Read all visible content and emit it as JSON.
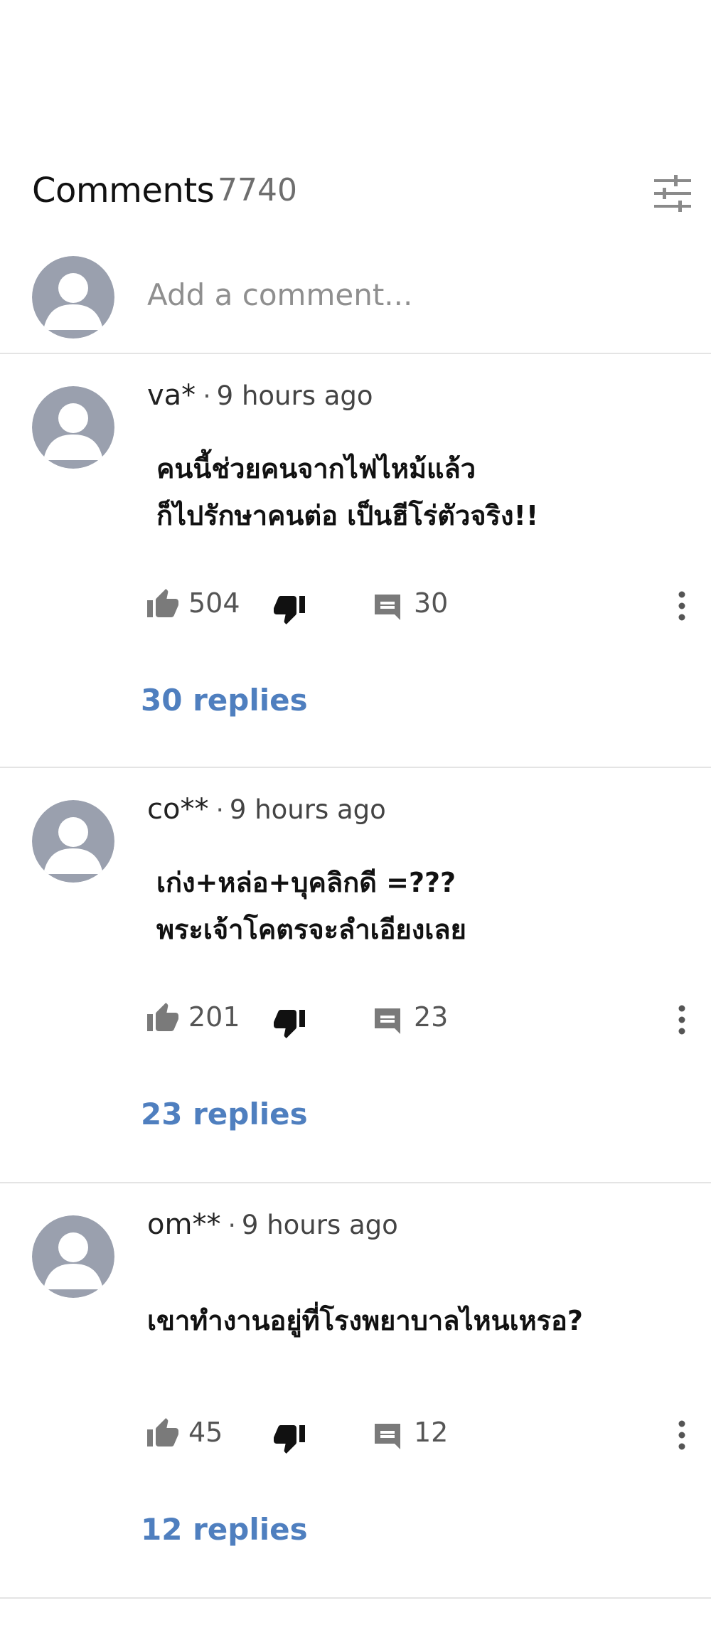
{
  "header": {
    "title": "Comments",
    "count": "7740",
    "filter_icon": "tune-icon"
  },
  "add_comment": {
    "placeholder": "Add a comment..."
  },
  "comments": [
    {
      "author": "va*",
      "separator": "·",
      "time": "9 hours ago",
      "lines": [
        "คนนี้ช่วยคนจากไฟไหม้แล้ว",
        "ก็ไปรักษาคนต่อ เป็นฮีโร่ตัวจริง!!"
      ],
      "likes": "504",
      "reply_count": "30",
      "replies_label": "30 replies"
    },
    {
      "author": "co**",
      "separator": "·",
      "time": "9 hours ago",
      "lines": [
        "เก่ง+หล่อ+บุคลิกดี =???",
        "พระเจ้าโคตรจะลำเอียงเลย"
      ],
      "likes": "201",
      "reply_count": "23",
      "replies_label": "23 replies"
    },
    {
      "author": "om**",
      "separator": "·",
      "time": "9 hours ago",
      "lines": [
        "เขาทำงานอยู่ที่โรงพยาบาลไหนเหรอ?"
      ],
      "likes": "45",
      "reply_count": "12",
      "replies_label": "12 replies"
    }
  ],
  "colors": {
    "link": "#4f7fbf",
    "avatar_bg": "#9aa0ae",
    "icon_gray": "#7a7a7a",
    "dislike": "#111111"
  }
}
